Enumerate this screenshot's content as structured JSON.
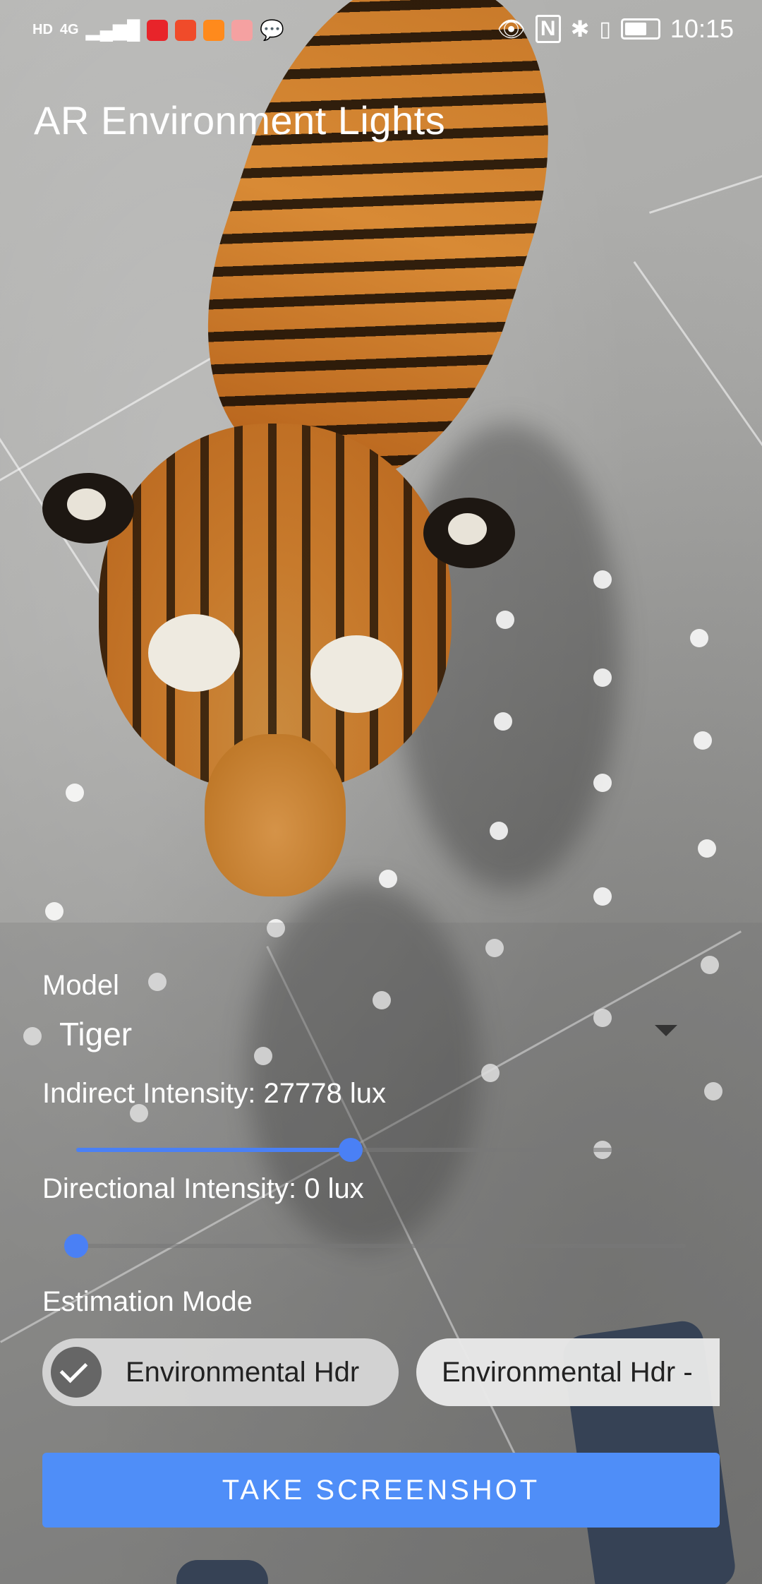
{
  "status_bar": {
    "left_text_hd": "HD",
    "left_text_net": "4G",
    "time": "10:15",
    "colors": {
      "app1": "#e8242a",
      "app2": "#f04b2a",
      "app3": "#ff8a1c",
      "app4": "#f5a1a1"
    }
  },
  "app": {
    "title": "AR Environment Lights"
  },
  "controls": {
    "model": {
      "label": "Model",
      "selected": "Tiger"
    },
    "indirect": {
      "label": "Indirect Intensity: 27778 lux",
      "fraction": 0.45
    },
    "directional": {
      "label": "Directional Intensity: 0 lux",
      "fraction": 0.0
    },
    "estimation": {
      "label": "Estimation Mode",
      "options": [
        {
          "label": "Environmental Hdr",
          "selected": true
        },
        {
          "label": "Environmental Hdr -",
          "selected": false
        }
      ]
    },
    "screenshot_button": "TAKE SCREENSHOT"
  },
  "colors": {
    "accent": "#4f8ef8",
    "slider": "#4a80f5"
  }
}
